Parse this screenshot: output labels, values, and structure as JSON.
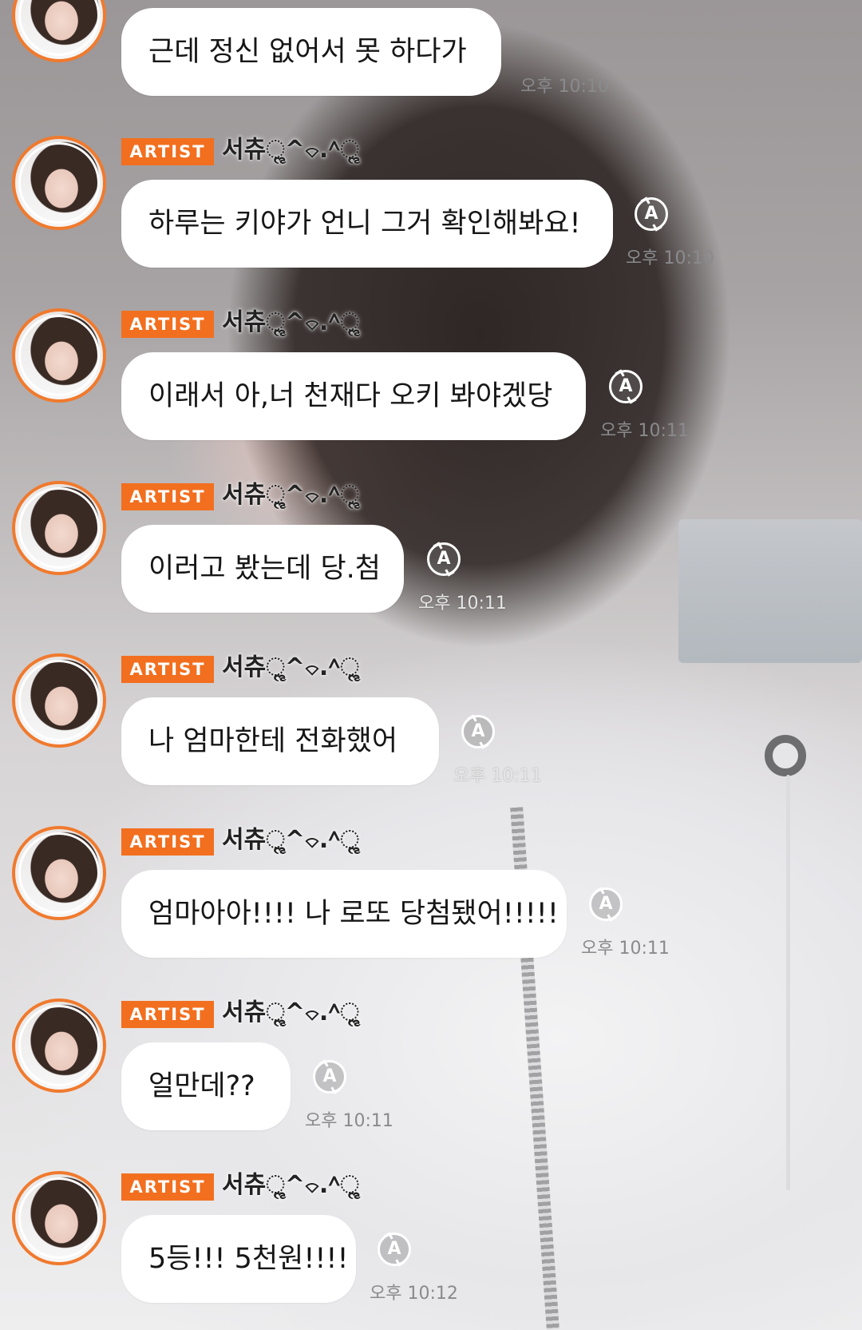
{
  "chat": {
    "artist_label": "ARTIST",
    "translate_icon_label": "A",
    "messages": [
      {
        "nickname": "",
        "text": "근데 정신 없어서 못 하다가",
        "time": "오후 10:10"
      },
      {
        "nickname": "서츄ૢ^⌔.^ૢ",
        "text": "하루는 키야가 언니 그거 확인해봐요!",
        "time": "오후 10:10"
      },
      {
        "nickname": "서츄ૢ^⌔.^ૢ",
        "text": "이래서 아,너 천재다 오키 봐야겠당",
        "time": "오후 10:11"
      },
      {
        "nickname": "서츄ૢ^⌔.^ૢ",
        "text": "이러고 봤는데 당.첨",
        "time": "오후 10:11"
      },
      {
        "nickname": "서츄ૢ^⌔.^ૢ",
        "text": "나 엄마한테 전화했어",
        "time": "오후 10:11"
      },
      {
        "nickname": "서츄ૢ^⌔.^ૢ",
        "text": "엄마아아!!!! 나 로또 당첨됐어!!!!!",
        "time": "오후 10:11"
      },
      {
        "nickname": "서츄ૢ^⌔.^ૢ",
        "text": "얼만데??",
        "time": "오후 10:11"
      },
      {
        "nickname": "서츄ૢ^⌔.^ૢ",
        "text": "5등!!! 5천원!!!!",
        "time": "오후 10:12"
      }
    ]
  },
  "colors": {
    "accent": "#f26f1f",
    "avatar_ring": "#f07a2e",
    "bubble": "#ffffff"
  }
}
